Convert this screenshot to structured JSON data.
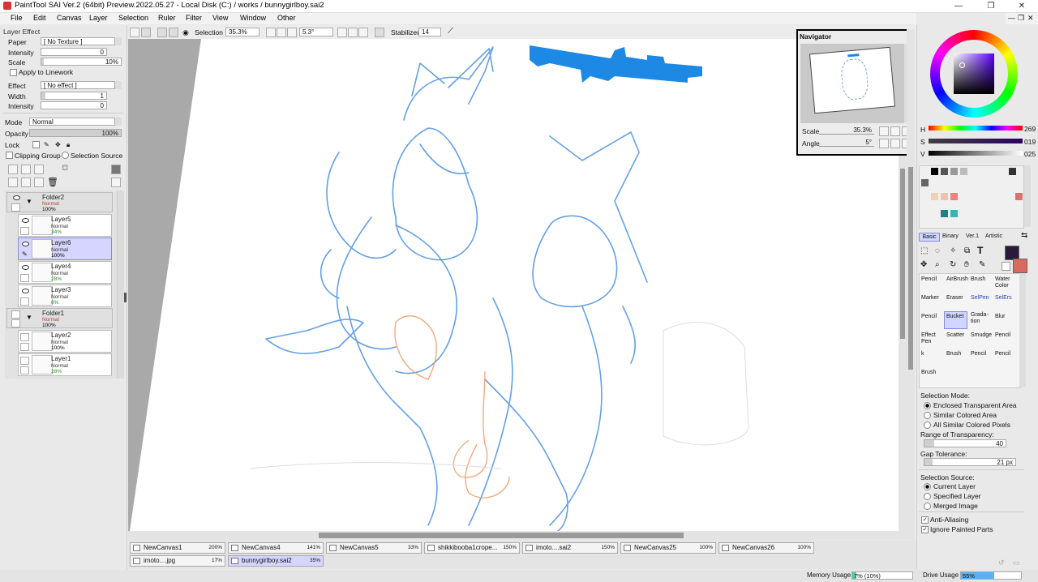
{
  "window": {
    "title": "PaintTool SAI Ver.2 (64bit) Preview.2022.05.27 - Local Disk (C:) / works / bunnygirlboy.sai2",
    "minimize": "—",
    "restore": "❐",
    "close": "✕"
  },
  "menu": [
    "File",
    "Edit",
    "Canvas",
    "Layer",
    "Selection",
    "Ruler",
    "Filter",
    "View",
    "Window",
    "Other"
  ],
  "menu_right": {
    "minimize": "—",
    "restore": "❐",
    "close": "✕"
  },
  "layer_effect": {
    "header": "Layer Effect",
    "paper_label": "Paper",
    "paper_value": "[ No Texture ]",
    "intensity_label": "Intensity",
    "intensity_value": "0",
    "scale_label": "Scale",
    "scale_value": "10%",
    "apply_linework": "Apply to Linework",
    "effect_label": "Effect",
    "effect_value": "[ No effect ]",
    "width_label": "Width",
    "width_value": "1",
    "intensity2_label": "Intensity",
    "intensity2_value": "0"
  },
  "layer_props": {
    "mode_label": "Mode",
    "mode_value": "Normal",
    "opacity_label": "Opacity",
    "opacity_value": "100%",
    "lock_label": "Lock",
    "clipping_group": "Clipping Group",
    "selection_source": "Selection Source"
  },
  "layers": [
    {
      "name": "Folder2",
      "mode": "Normal",
      "opacity": "100%"
    },
    {
      "name": "Layer5",
      "mode": "Normal",
      "opacity": "34%"
    },
    {
      "name": "Layer6",
      "mode": "Normal",
      "opacity": "100%"
    },
    {
      "name": "Layer4",
      "mode": "Normal",
      "opacity": "28%"
    },
    {
      "name": "Layer3",
      "mode": "Normal",
      "opacity": "8%"
    },
    {
      "name": "Folder1",
      "mode": "Normal",
      "opacity": "100%"
    },
    {
      "name": "Layer2",
      "mode": "Normal",
      "opacity": "100%"
    },
    {
      "name": "Layer1",
      "mode": "Normal",
      "opacity": "28%"
    }
  ],
  "toolbar": {
    "selection_label": "Selection",
    "zoom_value": "35.3%",
    "rotation_value": "5.3°",
    "stabilizer_label": "Stabilizer",
    "stabilizer_value": "14"
  },
  "navigator": {
    "title": "Navigator",
    "scale_label": "Scale",
    "scale_value": "35.3%",
    "angle_label": "Angle",
    "angle_value": "5°"
  },
  "color": {
    "h_label": "H",
    "h_value": "269",
    "s_label": "S",
    "s_value": "019",
    "v_label": "V",
    "v_value": "025",
    "primary": "#2a1a3a",
    "secondary": "#d86a5e"
  },
  "tool_tabs": [
    "Basic",
    "Binary",
    "Ver.1",
    "Artistic"
  ],
  "tools": [
    [
      "Pencil",
      "AirBrush",
      "Brush",
      "Water Color"
    ],
    [
      "Marker",
      "Eraser",
      "SelPen",
      "SelErs"
    ],
    [
      "Pencil",
      "Bucket",
      "Grada-tion",
      "Blur"
    ],
    [
      "Effect Pen",
      "Scatter",
      "Smudge",
      "Pencil"
    ],
    [
      "k",
      "Brush",
      "Pencil",
      "Pencil"
    ],
    [
      "Brush",
      "",
      "",
      ""
    ]
  ],
  "tool_options": {
    "selection_mode_label": "Selection Mode:",
    "modes": [
      "Enclosed Transparent Area",
      "Similar Colored Area",
      "All Similar Colored Pixels"
    ],
    "range_label": "Range of Transparency:",
    "range_value": "40",
    "gap_label": "Gap Tolerance:",
    "gap_value": "21 px",
    "source_label": "Selection Source:",
    "sources": [
      "Current Layer",
      "Specified Layer",
      "Merged Image"
    ],
    "anti_aliasing": "Anti-Aliasing",
    "ignore_painted": "Ignore Painted Parts"
  },
  "tabs": [
    {
      "name": "NewCanvas1",
      "zoom": "200%"
    },
    {
      "name": "NewCanvas4",
      "zoom": "141%"
    },
    {
      "name": "NewCanvas5",
      "zoom": "33%"
    },
    {
      "name": "shikkibooba1crope...",
      "zoom": "150%"
    },
    {
      "name": "imoto....sai2",
      "zoom": "150%"
    },
    {
      "name": "NewCanvas25",
      "zoom": "100%"
    },
    {
      "name": "NewCanvas26",
      "zoom": "100%"
    },
    {
      "name": "imoto....jpg",
      "zoom": "17%"
    },
    {
      "name": "bunnygirlboy.sai2",
      "zoom": "35%"
    }
  ],
  "status": {
    "memory_label": "Memory Usage",
    "memory_value": "7% (10%)",
    "memory_fraction": 0.07,
    "drive_label": "Drive Usage",
    "drive_value": "55%",
    "drive_fraction": 0.55
  },
  "icons": [
    "app-icon",
    "eye-icon",
    "folder-arrow-icon",
    "lock-icon",
    "new-layer-icon",
    "trash-icon",
    "rotate-icon",
    "zoom-in-icon",
    "zoom-out-icon",
    "gun-sketch"
  ]
}
